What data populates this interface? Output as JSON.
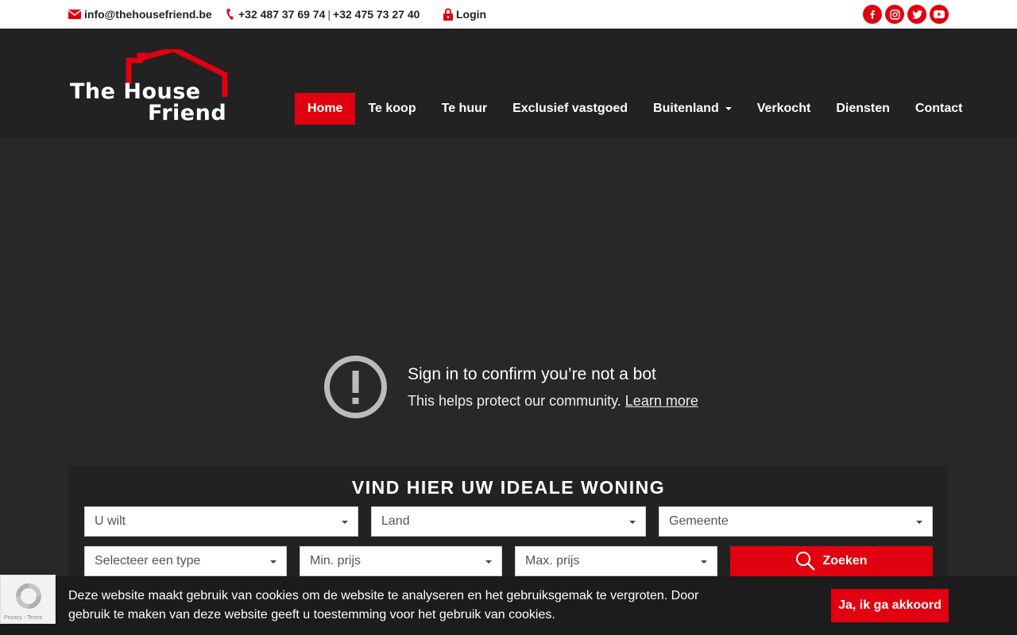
{
  "topbar": {
    "email": "info@thehousefriend.be",
    "phone1": "+32 487 37 69 74",
    "phone_separator": "|",
    "phone2": "+32 475 73 27 40",
    "login": "Login",
    "socials": [
      "facebook-icon",
      "instagram-icon",
      "twitter-icon",
      "youtube-icon"
    ]
  },
  "logo": {
    "line1": "The House",
    "line2": "Friend"
  },
  "nav": {
    "items": [
      {
        "label": "Home",
        "active": true
      },
      {
        "label": "Te koop"
      },
      {
        "label": "Te huur"
      },
      {
        "label": "Exclusief vastgoed"
      },
      {
        "label": "Buitenland",
        "dropdown": true
      },
      {
        "label": "Verkocht"
      },
      {
        "label": "Diensten"
      },
      {
        "label": "Contact"
      }
    ]
  },
  "video_notice": {
    "title": "Sign in to confirm you’re not a bot",
    "subtitle": "This helps protect our community.",
    "link": "Learn more"
  },
  "search": {
    "title": "VIND HIER UW IDEALE WONING",
    "row1": [
      "U wilt",
      "Land",
      "Gemeente"
    ],
    "row2": [
      "Selecteer een type",
      "Min. prijs",
      "Max. prijs"
    ],
    "button": "Zoeken"
  },
  "cookie": {
    "text": "Deze website maakt gebruik van cookies om de website te analyseren en het gebruiksgemak te vergroten. Door gebruik te maken van deze website geeft u toestemming voor het gebruik van cookies.",
    "accept": "Ja, ik ga akkoord"
  },
  "recaptcha": {
    "footer": "Privacy - Terms"
  },
  "colors": {
    "brand_red": "#e0000f",
    "header_bg": "#222222",
    "hero_bg": "#282828"
  }
}
